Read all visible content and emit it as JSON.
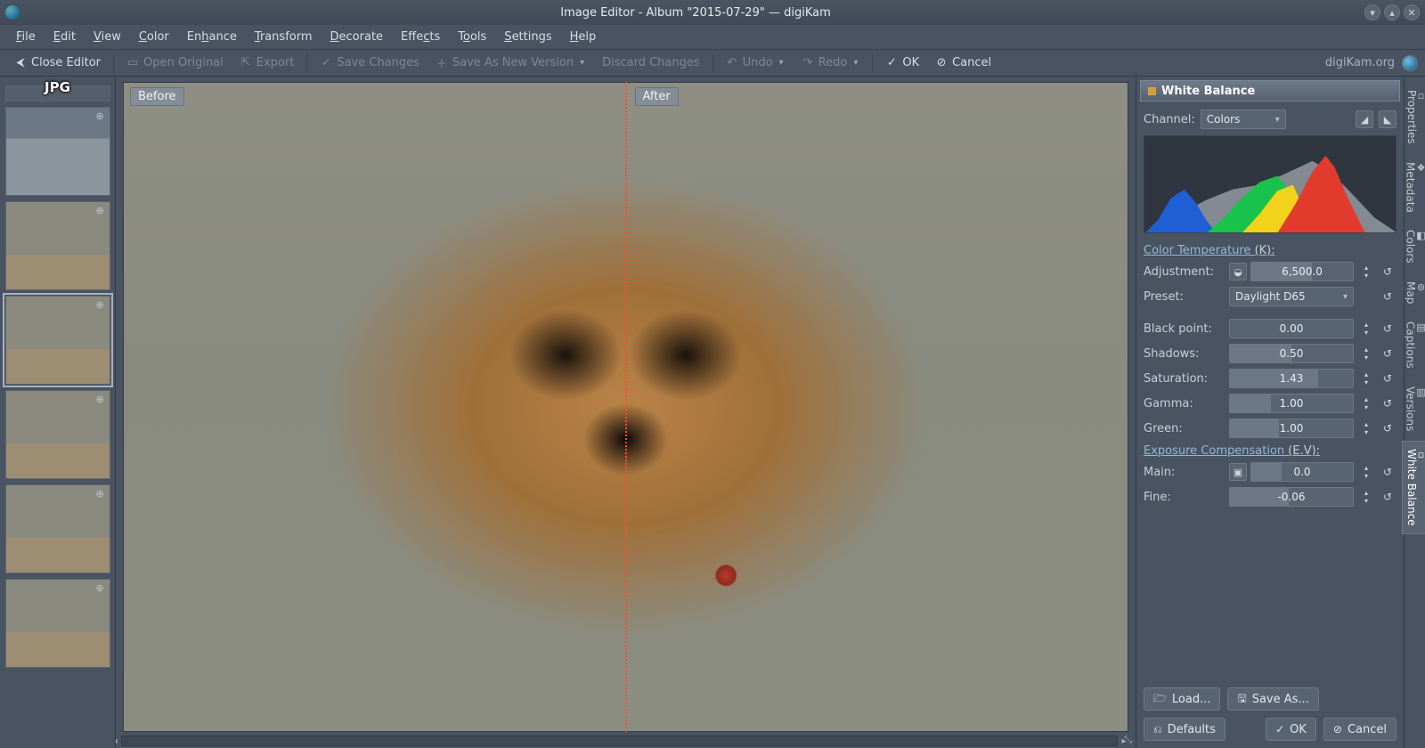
{
  "window": {
    "title": "Image Editor - Album \"2015-07-29\" — digiKam"
  },
  "menu": {
    "file": "File",
    "edit": "Edit",
    "view": "View",
    "color": "Color",
    "enhance": "Enhance",
    "transform": "Transform",
    "decorate": "Decorate",
    "effects": "Effects",
    "tools": "Tools",
    "settings": "Settings",
    "help": "Help"
  },
  "toolbar": {
    "close": "Close Editor",
    "open_original": "Open Original",
    "export": "Export",
    "save_changes": "Save Changes",
    "save_as_new": "Save As New Version",
    "discard": "Discard Changes",
    "undo": "Undo",
    "redo": "Redo",
    "ok": "OK",
    "cancel": "Cancel",
    "brand": "digiKam.org"
  },
  "thumbs": {
    "format": "JPG"
  },
  "compare": {
    "before": "Before",
    "after": "After"
  },
  "panel": {
    "title": "White Balance",
    "channel_label": "Channel:",
    "channel_value": "Colors",
    "sections": {
      "color_temp": {
        "title": "Color Temperature",
        "unit": "(K):"
      },
      "exposure": {
        "title": "Exposure Compensation",
        "unit": "(E.V):"
      }
    },
    "params": {
      "adjustment": {
        "label": "Adjustment:",
        "value": "6,500.0",
        "fill": 60
      },
      "preset": {
        "label": "Preset:",
        "value": "Daylight D65"
      },
      "black": {
        "label": "Black point:",
        "value": "0.00",
        "fill": 0
      },
      "shadows": {
        "label": "Shadows:",
        "value": "0.50",
        "fill": 50
      },
      "saturation": {
        "label": "Saturation:",
        "value": "1.43",
        "fill": 72
      },
      "gamma": {
        "label": "Gamma:",
        "value": "1.00",
        "fill": 33
      },
      "green": {
        "label": "Green:",
        "value": "1.00",
        "fill": 40
      },
      "main": {
        "label": "Main:",
        "value": "0.0",
        "fill": 30
      },
      "fine": {
        "label": "Fine:",
        "value": "-0.06",
        "fill": 48
      }
    },
    "buttons": {
      "load": "Load...",
      "save": "Save As...",
      "defaults": "Defaults",
      "ok": "OK",
      "cancel": "Cancel"
    }
  },
  "vtabs": {
    "properties": "Properties",
    "metadata": "Metadata",
    "colors": "Colors",
    "map": "Map",
    "captions": "Captions",
    "versions": "Versions",
    "white_balance": "White Balance"
  }
}
